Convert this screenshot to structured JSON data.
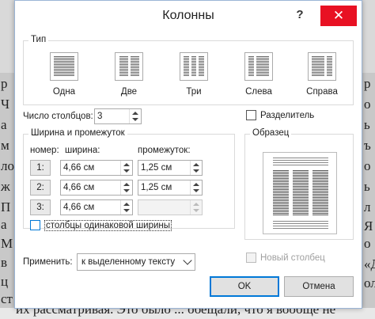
{
  "background_document": {
    "left_lines": [
      "р",
      "Ч",
      "а",
      "м",
      "ло",
      "ж",
      "П",
      "а",
      "М",
      "в",
      "ц",
      "ст"
    ],
    "right_lines": [
      "р",
      "о",
      "ь",
      "ъ",
      "о",
      "ь",
      "л",
      "Я",
      "о",
      "«Д",
      "ол"
    ],
    "bottom_text": "их рассматривая. Это было ... обещали, что я вообще не"
  },
  "dialog": {
    "title": "Колонны",
    "help": "?",
    "close": "✕"
  },
  "presets": {
    "group_label": "Тип",
    "items": [
      {
        "label": "Одна",
        "columns": 1
      },
      {
        "label": "Две",
        "columns": 2
      },
      {
        "label": "Три",
        "columns": 3
      },
      {
        "label": "Слева",
        "columns": 2
      },
      {
        "label": "Справа",
        "columns": 2
      }
    ]
  },
  "columns_count": {
    "label": "Число столбцов:",
    "value": "3"
  },
  "separator": {
    "label": "Разделитель",
    "checked": false
  },
  "width_spacing": {
    "group_label": "Ширина и промежуток",
    "header_num": "номер:",
    "header_width": "ширина:",
    "header_spacing": "промежуток:",
    "rows": [
      {
        "num": "1:",
        "width": "4,66 см",
        "spacing": "1,25 см"
      },
      {
        "num": "2:",
        "width": "4,66 см",
        "spacing": "1,25 см"
      },
      {
        "num": "3:",
        "width": "4,66 см",
        "spacing": ""
      }
    ]
  },
  "equal_width": {
    "label": "столбцы одинаковой ширины",
    "checked": false
  },
  "sample": {
    "group_label": "Образец"
  },
  "apply": {
    "label": "Применить:",
    "value": "к выделенному тексту"
  },
  "new_column": {
    "label": "Новый столбец",
    "checked": false,
    "disabled": true
  },
  "buttons": {
    "ok": "OK",
    "cancel": "Отмена"
  }
}
